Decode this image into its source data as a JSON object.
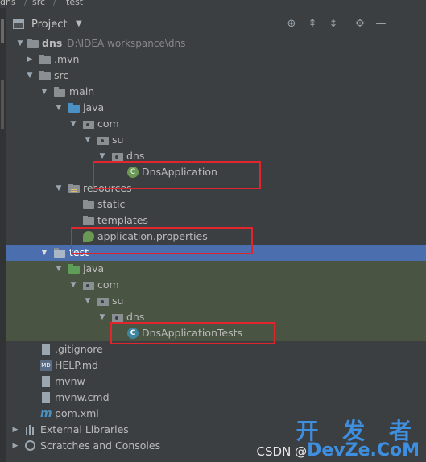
{
  "breadcrumb": {
    "items": [
      "dns",
      "src",
      "test"
    ]
  },
  "toolbar": {
    "title": "Project",
    "dropdown_icon": "chevron-down-icon"
  },
  "tree": {
    "root": {
      "name": "dns",
      "path": "D:\\IDEA workspance\\dns"
    },
    "mvn": ".mvn",
    "src": "src",
    "main": "main",
    "main_java": "java",
    "main_com": "com",
    "main_su": "su",
    "main_dns": "dns",
    "dns_application": "DnsApplication",
    "resources": "resources",
    "static": "static",
    "templates": "templates",
    "application_properties": "application.properties",
    "test": "test",
    "test_java": "java",
    "test_com": "com",
    "test_su": "su",
    "test_dns": "dns",
    "dns_application_tests": "DnsApplicationTests",
    "gitignore": ".gitignore",
    "help_md": "HELP.md",
    "mvnw": "mvnw",
    "mvnw_cmd": "mvnw.cmd",
    "pom_xml": "pom.xml",
    "external_libraries": "External Libraries",
    "scratches": "Scratches and Consoles"
  },
  "icons": {
    "md_badge": "MD",
    "maven": "m",
    "class": "C"
  },
  "watermark": {
    "top": "开 发 者",
    "source": "CSDN @",
    "brand": "DevZe.CoM"
  },
  "colors": {
    "selection": "#4b6eaf",
    "test_background": "#4a5443",
    "annotation_red": "#e0262c",
    "source_folder": "#4a90c2",
    "test_folder": "#5e9e58"
  }
}
